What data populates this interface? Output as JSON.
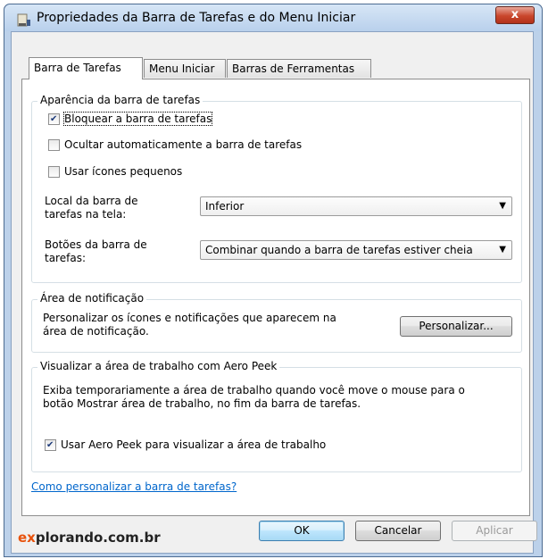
{
  "window": {
    "title": "Propriedades da Barra de Tarefas e do Menu Iniciar",
    "close_label": "x"
  },
  "tabs": [
    {
      "label": "Barra de Tarefas",
      "active": true
    },
    {
      "label": "Menu Iniciar",
      "active": false
    },
    {
      "label": "Barras de Ferramentas",
      "active": false
    }
  ],
  "appearance": {
    "legend": "Aparência da barra de tarefas",
    "lock": {
      "label": "Bloquear a barra de tarefas",
      "checked": true
    },
    "autohide": {
      "label": "Ocultar automaticamente a barra de tarefas",
      "checked": false
    },
    "small_icons": {
      "label": "Usar ícones pequenos",
      "checked": false
    },
    "location_label_line1": "Local da barra de",
    "location_label_line2": "tarefas na tela:",
    "location_value": "Inferior",
    "buttons_label_line1": "Botões da barra de",
    "buttons_label_line2": "tarefas:",
    "buttons_value": "Combinar quando a barra de tarefas estiver cheia"
  },
  "notification": {
    "legend": "Área de notificação",
    "text_line1": "Personalizar os ícones e notificações que aparecem na",
    "text_line2": "área de notificação.",
    "customize_label": "Personalizar..."
  },
  "aero_peek": {
    "legend": "Visualizar a área de trabalho com Aero Peek",
    "text_line1": "Exiba temporariamente a área de trabalho quando você move o mouse para o",
    "text_line2": "botão Mostrar área de trabalho, no fim da barra de tarefas.",
    "checkbox": {
      "label": "Usar Aero Peek para visualizar a área de trabalho",
      "checked": true
    }
  },
  "help_link": "Como personalizar a barra de tarefas?",
  "footer": {
    "brand_accent": "ex",
    "brand_rest": "plorando.com.br",
    "ok_label": "OK",
    "cancel_label": "Cancelar",
    "apply_label": "Aplicar"
  },
  "colors": {
    "link": "#0066cc",
    "brand_accent": "#e8520c",
    "close_button": "#c9462c"
  }
}
